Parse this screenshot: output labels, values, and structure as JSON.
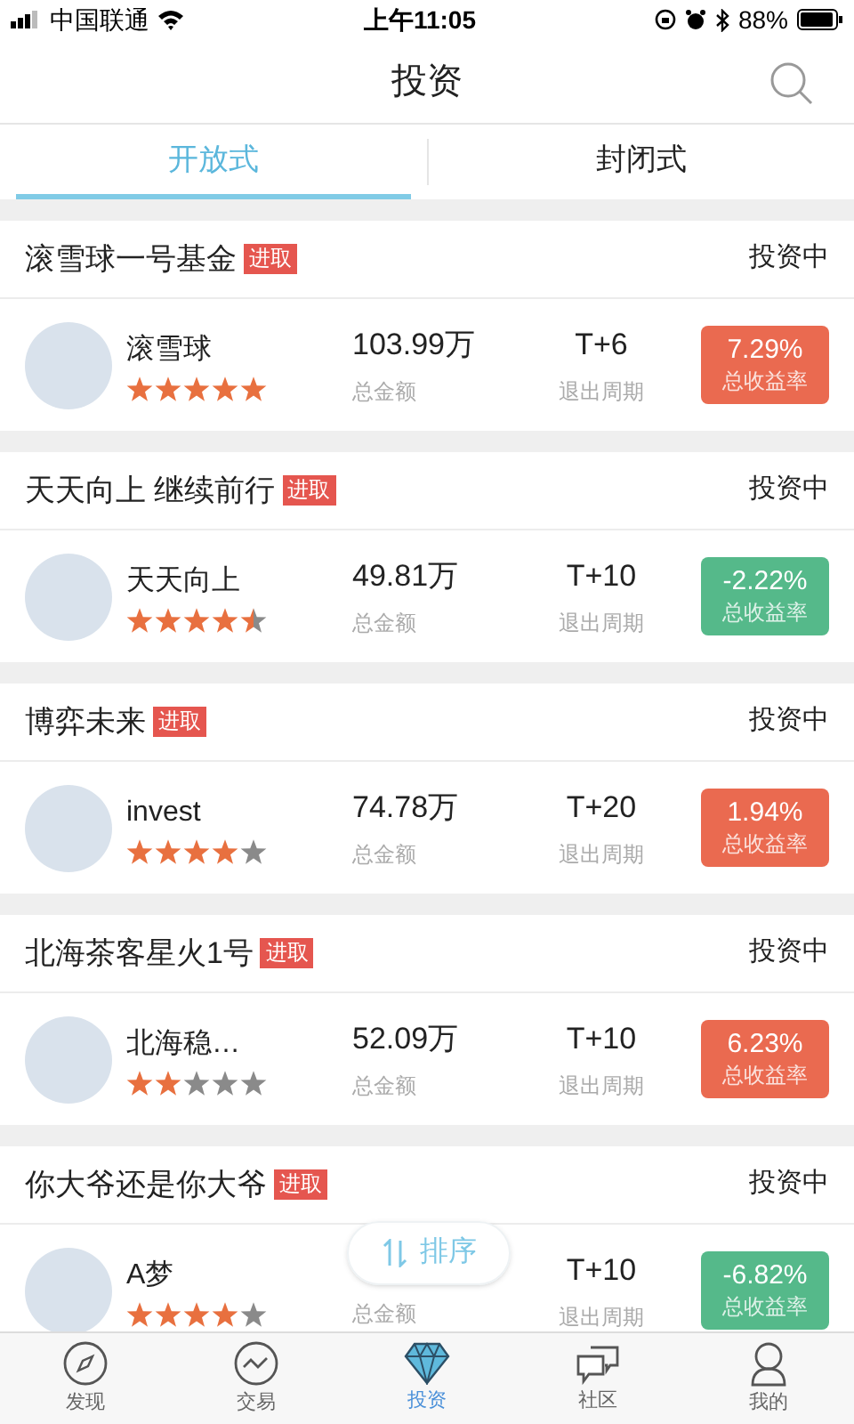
{
  "status_bar": {
    "carrier": "中国联通",
    "time": "上午11:05",
    "battery": "88%"
  },
  "header": {
    "title": "投资"
  },
  "tabs": [
    {
      "label": "开放式",
      "selected": true
    },
    {
      "label": "封闭式",
      "selected": false
    }
  ],
  "funds": [
    {
      "title": "滚雪球一号基金",
      "tag": "进取",
      "status": "投资中",
      "name": "滚雪球",
      "stars": 5,
      "amount": "103.99万",
      "amount_label": "总金额",
      "period": "T+6",
      "period_label": "退出周期",
      "return": "7.29%",
      "return_label": "总收益率",
      "color": "#ea6a50"
    },
    {
      "title": "天天向上 继续前行",
      "tag": "进取",
      "status": "投资中",
      "name": "天天向上",
      "stars": 4.5,
      "amount": "49.81万",
      "amount_label": "总金额",
      "period": "T+10",
      "period_label": "退出周期",
      "return": "-2.22%",
      "return_label": "总收益率",
      "color": "#55b98a"
    },
    {
      "title": "博弈未来",
      "tag": "进取",
      "status": "投资中",
      "name": "invest",
      "stars": 4,
      "amount": "74.78万",
      "amount_label": "总金额",
      "period": "T+20",
      "period_label": "退出周期",
      "return": "1.94%",
      "return_label": "总收益率",
      "color": "#ea6a50"
    },
    {
      "title": "北海茶客星火1号",
      "tag": "进取",
      "status": "投资中",
      "name": "北海稳…",
      "stars": 2,
      "amount": "52.09万",
      "amount_label": "总金额",
      "period": "T+10",
      "period_label": "退出周期",
      "return": "6.23%",
      "return_label": "总收益率",
      "color": "#ea6a50"
    },
    {
      "title": "你大爷还是你大爷",
      "tag": "进取",
      "status": "投资中",
      "name": "A梦",
      "stars": 4,
      "amount_label": "总金额",
      "period": "T+10",
      "period_label": "退出周期",
      "return": "-6.82%",
      "return_label": "总收益率",
      "color": "#55b98a"
    }
  ],
  "sort_button": {
    "label": "排序"
  },
  "tab_bar": [
    {
      "label": "发现",
      "selected": false
    },
    {
      "label": "交易",
      "selected": false
    },
    {
      "label": "投资",
      "selected": true
    },
    {
      "label": "社区",
      "selected": false
    },
    {
      "label": "我的",
      "selected": false
    }
  ]
}
